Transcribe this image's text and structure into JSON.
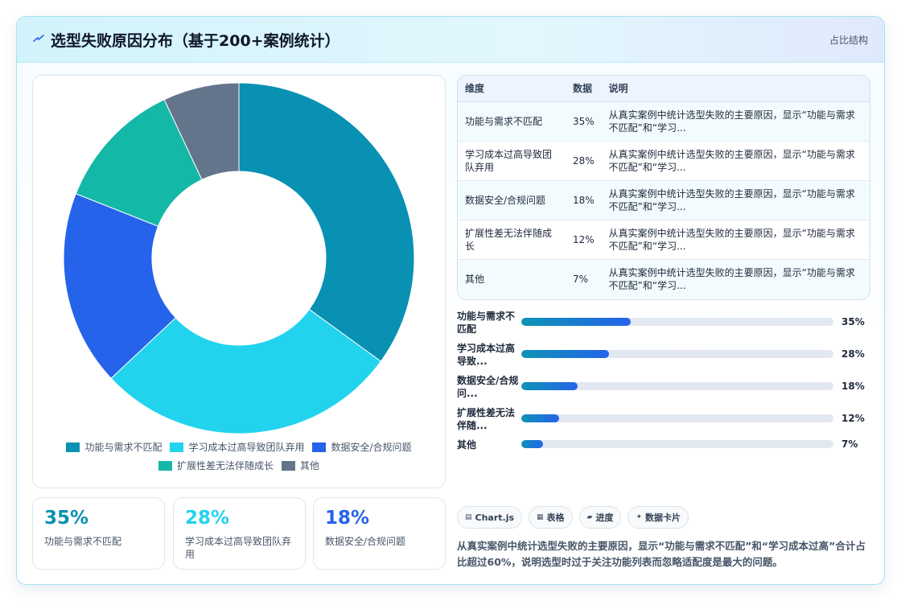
{
  "header": {
    "title": "选型失败原因分布（基于200+案例统计）",
    "tag": "占比结构"
  },
  "colors": {
    "accent": "#0e93b5",
    "series": [
      "#0891b2",
      "#22d3ee",
      "#2563eb",
      "#14b8a6",
      "#64748b"
    ]
  },
  "chart_data": {
    "type": "pie",
    "style": "doughnut",
    "categories": [
      "功能与需求不匹配",
      "学习成本过高导致团队弃用",
      "数据安全/合规问题",
      "扩展性差无法伴随成长",
      "其他"
    ],
    "values": [
      35,
      28,
      18,
      12,
      7
    ],
    "unit": "%",
    "legend_position": "bottom"
  },
  "stats": [
    {
      "value": "35%",
      "label": "功能与需求不匹配",
      "color": "#0891b2"
    },
    {
      "value": "28%",
      "label": "学习成本过高导致团队弃用",
      "color": "#22d3ee"
    },
    {
      "value": "18%",
      "label": "数据安全/合规问题",
      "color": "#2563eb"
    }
  ],
  "table": {
    "headers": [
      "维度",
      "数据",
      "说明"
    ],
    "rows": [
      {
        "dim": "功能与需求不匹配",
        "val": "35%",
        "desc": "从真实案例中统计选型失败的主要原因，显示“功能与需求不匹配”和“学习..."
      },
      {
        "dim": "学习成本过高导致团队弃用",
        "val": "28%",
        "desc": "从真实案例中统计选型失败的主要原因，显示“功能与需求不匹配”和“学习..."
      },
      {
        "dim": "数据安全/合规问题",
        "val": "18%",
        "desc": "从真实案例中统计选型失败的主要原因，显示“功能与需求不匹配”和“学习..."
      },
      {
        "dim": "扩展性差无法伴随成长",
        "val": "12%",
        "desc": "从真实案例中统计选型失败的主要原因，显示“功能与需求不匹配”和“学习..."
      },
      {
        "dim": "其他",
        "val": "7%",
        "desc": "从真实案例中统计选型失败的主要原因，显示“功能与需求不匹配”和“学习..."
      }
    ]
  },
  "progress": [
    {
      "label": "功能与需求不匹配",
      "value": 35,
      "value_text": "35%"
    },
    {
      "label": "学习成本过高导致...",
      "value": 28,
      "value_text": "28%"
    },
    {
      "label": "数据安全/合规问...",
      "value": 18,
      "value_text": "18%"
    },
    {
      "label": "扩展性差无法伴随...",
      "value": 12,
      "value_text": "12%"
    },
    {
      "label": "其他",
      "value": 7,
      "value_text": "7%"
    }
  ],
  "chips": [
    {
      "icon": "▤",
      "icon_name": "chart-icon",
      "label": "Chart.js"
    },
    {
      "icon": "▦",
      "icon_name": "table-icon",
      "label": "表格"
    },
    {
      "icon": "▰",
      "icon_name": "progress-icon",
      "label": "进度"
    },
    {
      "icon": "✦",
      "icon_name": "card-icon",
      "label": "数据卡片"
    }
  ],
  "summary": "从真实案例中统计选型失败的主要原因，显示“功能与需求不匹配”和“学习成本过高”合计占比超过60%，说明选型时过于关注功能列表而忽略适配度是最大的问题。"
}
